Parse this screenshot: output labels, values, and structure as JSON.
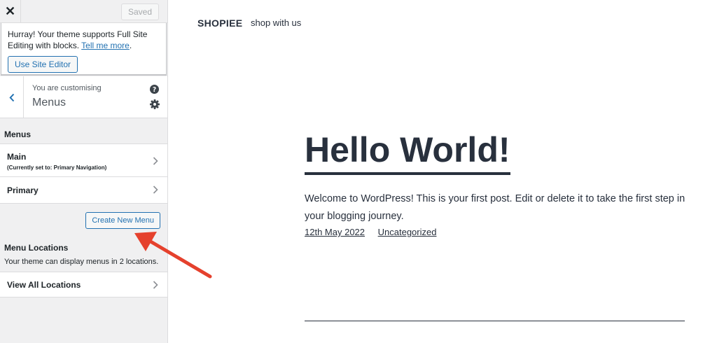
{
  "colors": {
    "accent": "#2271b1",
    "annotation_arrow": "#e5412d",
    "sidebar_bg": "#f0f0f1",
    "preview_text": "#28303d"
  },
  "topbar": {
    "close_glyph": "✕",
    "close_icon": "close-icon",
    "save_label": "Saved"
  },
  "notice": {
    "text": "Hurray! Your theme supports Full Site Editing with blocks.",
    "link": "Tell me more",
    "link_suffix": ".",
    "button": "Use Site Editor"
  },
  "panel": {
    "label": "You are customising",
    "title": "Menus",
    "back_icon": "chevron-left-icon",
    "help_icon": "help-icon",
    "settings_icon": "gear-icon"
  },
  "menus": {
    "heading": "Menus",
    "items": [
      {
        "title": "Main",
        "subtitle": "(Currently set to: Primary Navigation)"
      },
      {
        "title": "Primary"
      }
    ],
    "create_button": "Create New Menu"
  },
  "locations": {
    "heading": "Menu Locations",
    "description": "Your theme can display menus in 2 locations.",
    "view_all": "View All Locations"
  },
  "preview": {
    "site_title": "SHOPIEE",
    "tagline": "shop with us",
    "post_title": "Hello World!",
    "excerpt": "Welcome to WordPress! This is your first post. Edit or delete it to take the first step in your blogging journey.",
    "date": "12th May 2022",
    "category": "Uncategorized"
  }
}
